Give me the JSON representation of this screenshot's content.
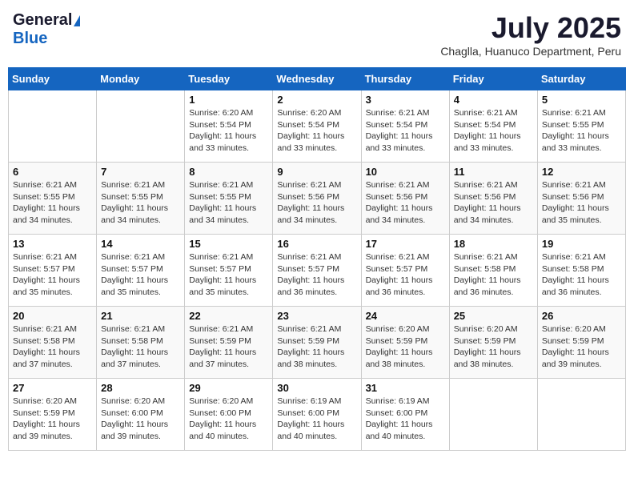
{
  "logo": {
    "general": "General",
    "blue": "Blue"
  },
  "title": "July 2025",
  "subtitle": "Chaglla, Huanuco Department, Peru",
  "days_of_week": [
    "Sunday",
    "Monday",
    "Tuesday",
    "Wednesday",
    "Thursday",
    "Friday",
    "Saturday"
  ],
  "weeks": [
    [
      {
        "day": "",
        "info": ""
      },
      {
        "day": "",
        "info": ""
      },
      {
        "day": "1",
        "info": "Sunrise: 6:20 AM\nSunset: 5:54 PM\nDaylight: 11 hours and 33 minutes."
      },
      {
        "day": "2",
        "info": "Sunrise: 6:20 AM\nSunset: 5:54 PM\nDaylight: 11 hours and 33 minutes."
      },
      {
        "day": "3",
        "info": "Sunrise: 6:21 AM\nSunset: 5:54 PM\nDaylight: 11 hours and 33 minutes."
      },
      {
        "day": "4",
        "info": "Sunrise: 6:21 AM\nSunset: 5:54 PM\nDaylight: 11 hours and 33 minutes."
      },
      {
        "day": "5",
        "info": "Sunrise: 6:21 AM\nSunset: 5:55 PM\nDaylight: 11 hours and 33 minutes."
      }
    ],
    [
      {
        "day": "6",
        "info": "Sunrise: 6:21 AM\nSunset: 5:55 PM\nDaylight: 11 hours and 34 minutes."
      },
      {
        "day": "7",
        "info": "Sunrise: 6:21 AM\nSunset: 5:55 PM\nDaylight: 11 hours and 34 minutes."
      },
      {
        "day": "8",
        "info": "Sunrise: 6:21 AM\nSunset: 5:55 PM\nDaylight: 11 hours and 34 minutes."
      },
      {
        "day": "9",
        "info": "Sunrise: 6:21 AM\nSunset: 5:56 PM\nDaylight: 11 hours and 34 minutes."
      },
      {
        "day": "10",
        "info": "Sunrise: 6:21 AM\nSunset: 5:56 PM\nDaylight: 11 hours and 34 minutes."
      },
      {
        "day": "11",
        "info": "Sunrise: 6:21 AM\nSunset: 5:56 PM\nDaylight: 11 hours and 34 minutes."
      },
      {
        "day": "12",
        "info": "Sunrise: 6:21 AM\nSunset: 5:56 PM\nDaylight: 11 hours and 35 minutes."
      }
    ],
    [
      {
        "day": "13",
        "info": "Sunrise: 6:21 AM\nSunset: 5:57 PM\nDaylight: 11 hours and 35 minutes."
      },
      {
        "day": "14",
        "info": "Sunrise: 6:21 AM\nSunset: 5:57 PM\nDaylight: 11 hours and 35 minutes."
      },
      {
        "day": "15",
        "info": "Sunrise: 6:21 AM\nSunset: 5:57 PM\nDaylight: 11 hours and 35 minutes."
      },
      {
        "day": "16",
        "info": "Sunrise: 6:21 AM\nSunset: 5:57 PM\nDaylight: 11 hours and 36 minutes."
      },
      {
        "day": "17",
        "info": "Sunrise: 6:21 AM\nSunset: 5:57 PM\nDaylight: 11 hours and 36 minutes."
      },
      {
        "day": "18",
        "info": "Sunrise: 6:21 AM\nSunset: 5:58 PM\nDaylight: 11 hours and 36 minutes."
      },
      {
        "day": "19",
        "info": "Sunrise: 6:21 AM\nSunset: 5:58 PM\nDaylight: 11 hours and 36 minutes."
      }
    ],
    [
      {
        "day": "20",
        "info": "Sunrise: 6:21 AM\nSunset: 5:58 PM\nDaylight: 11 hours and 37 minutes."
      },
      {
        "day": "21",
        "info": "Sunrise: 6:21 AM\nSunset: 5:58 PM\nDaylight: 11 hours and 37 minutes."
      },
      {
        "day": "22",
        "info": "Sunrise: 6:21 AM\nSunset: 5:59 PM\nDaylight: 11 hours and 37 minutes."
      },
      {
        "day": "23",
        "info": "Sunrise: 6:21 AM\nSunset: 5:59 PM\nDaylight: 11 hours and 38 minutes."
      },
      {
        "day": "24",
        "info": "Sunrise: 6:20 AM\nSunset: 5:59 PM\nDaylight: 11 hours and 38 minutes."
      },
      {
        "day": "25",
        "info": "Sunrise: 6:20 AM\nSunset: 5:59 PM\nDaylight: 11 hours and 38 minutes."
      },
      {
        "day": "26",
        "info": "Sunrise: 6:20 AM\nSunset: 5:59 PM\nDaylight: 11 hours and 39 minutes."
      }
    ],
    [
      {
        "day": "27",
        "info": "Sunrise: 6:20 AM\nSunset: 5:59 PM\nDaylight: 11 hours and 39 minutes."
      },
      {
        "day": "28",
        "info": "Sunrise: 6:20 AM\nSunset: 6:00 PM\nDaylight: 11 hours and 39 minutes."
      },
      {
        "day": "29",
        "info": "Sunrise: 6:20 AM\nSunset: 6:00 PM\nDaylight: 11 hours and 40 minutes."
      },
      {
        "day": "30",
        "info": "Sunrise: 6:19 AM\nSunset: 6:00 PM\nDaylight: 11 hours and 40 minutes."
      },
      {
        "day": "31",
        "info": "Sunrise: 6:19 AM\nSunset: 6:00 PM\nDaylight: 11 hours and 40 minutes."
      },
      {
        "day": "",
        "info": ""
      },
      {
        "day": "",
        "info": ""
      }
    ]
  ]
}
